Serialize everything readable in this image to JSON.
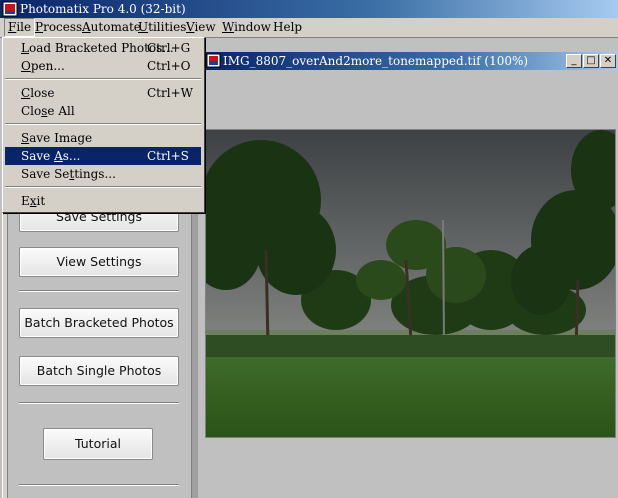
{
  "app": {
    "title": "Photomatix Pro 4.0 (32-bit)",
    "icon": "photomatix-app-icon"
  },
  "menubar": {
    "items": [
      {
        "label": "File",
        "accel": "F",
        "rest": "ile"
      },
      {
        "label": "Process",
        "accel": "P",
        "rest": "rocess"
      },
      {
        "label": "Automate",
        "accel": "A",
        "rest": "utomate"
      },
      {
        "label": "Utilities",
        "accel": "U",
        "rest": "tilities"
      },
      {
        "label": "View",
        "accel": "V",
        "rest": "iew"
      },
      {
        "label": "Window",
        "accel": "W",
        "rest": "indow"
      },
      {
        "label": "Help",
        "accel": "",
        "rest": "Help"
      }
    ]
  },
  "file_menu": {
    "items": [
      {
        "pre": "",
        "accel": "L",
        "post": "oad Bracketed Photos...",
        "shortcut": "Ctrl+G"
      },
      {
        "pre": "",
        "accel": "O",
        "post": "pen...",
        "shortcut": "Ctrl+O"
      },
      {
        "pre": "",
        "accel": "C",
        "post": "lose",
        "shortcut": "Ctrl+W"
      },
      {
        "pre": "Clo",
        "accel": "s",
        "post": "e All",
        "shortcut": ""
      },
      {
        "pre": "",
        "accel": "S",
        "post": "ave Image",
        "shortcut": ""
      },
      {
        "pre": "Save ",
        "accel": "A",
        "post": "s...",
        "shortcut": "Ctrl+S"
      },
      {
        "pre": "Save Se",
        "accel": "t",
        "post": "tings...",
        "shortcut": ""
      },
      {
        "pre": "E",
        "accel": "x",
        "post": "it",
        "shortcut": ""
      }
    ],
    "highlighted": "Save As..."
  },
  "palette": {
    "buttons": {
      "save_settings": "Save Settings",
      "view_settings": "View Settings",
      "batch_bracketed": "Batch Bracketed Photos",
      "batch_single": "Batch Single Photos",
      "tutorial": "Tutorial"
    }
  },
  "image_window": {
    "title": "IMG_8807_overAnd2more_tonemapped.tif (100%)",
    "controls": {
      "minimize": "_",
      "maximize": "□",
      "close": "✕"
    }
  },
  "colors": {
    "titlebar_start": "#0a246a",
    "titlebar_end": "#a6caf0",
    "menu_highlight": "#0a246a",
    "chrome": "#d4d0c8"
  }
}
